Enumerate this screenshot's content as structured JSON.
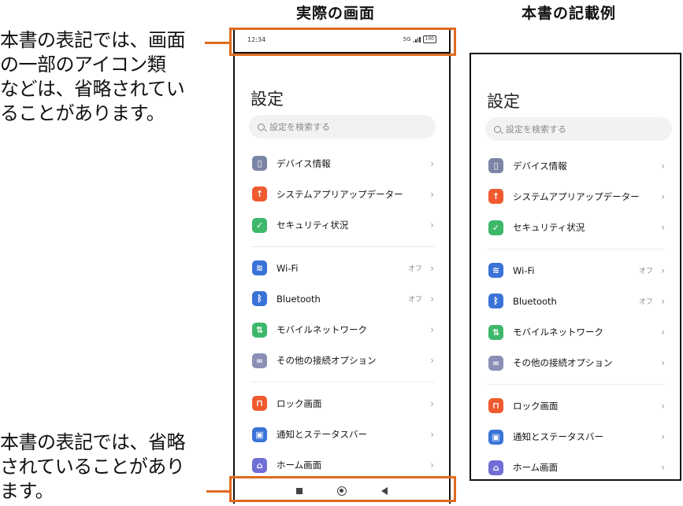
{
  "headings": {
    "actual": "実際の画面",
    "manual": "本書の記載例"
  },
  "notes": {
    "top": "本書の表記では、画面\nの一部のアイコン類\nなどは、省略されてい\nることがあります。",
    "bottom": "本書の表記では、省略\nされていることがあり\nます。"
  },
  "status_bar": {
    "time": "12:34",
    "network": "5G",
    "battery": "100"
  },
  "settings": {
    "title": "設定",
    "search_placeholder": "設定を検索する",
    "items": [
      {
        "label": "デバイス情報",
        "icon": "device-icon",
        "color": "#7b86a6",
        "meta": ""
      },
      {
        "label": "システムアプリアップデーター",
        "icon": "update-arrow-icon",
        "color": "#ef5a2f",
        "meta": ""
      },
      {
        "label": "セキュリティ状況",
        "icon": "shield-check-icon",
        "color": "#3db86b",
        "meta": ""
      },
      {
        "label": "Wi-Fi",
        "icon": "wifi-icon",
        "color": "#3a73d8",
        "meta": "オフ"
      },
      {
        "label": "Bluetooth",
        "icon": "bluetooth-icon",
        "color": "#3a73d8",
        "meta": "オフ"
      },
      {
        "label": "モバイルネットワーク",
        "icon": "mobile-network-icon",
        "color": "#3db86b",
        "meta": ""
      },
      {
        "label": "その他の接続オプション",
        "icon": "link-icon",
        "color": "#8b8fb6",
        "meta": ""
      },
      {
        "label": "ロック画面",
        "icon": "lock-icon",
        "color": "#ef5a2f",
        "meta": ""
      },
      {
        "label": "通知とステータスバー",
        "icon": "notification-icon",
        "color": "#3a73d8",
        "meta": ""
      },
      {
        "label": "ホーム画面",
        "icon": "home-icon",
        "color": "#6f6fd6",
        "meta": ""
      }
    ]
  },
  "colors": {
    "callout": "#e06a1e"
  }
}
